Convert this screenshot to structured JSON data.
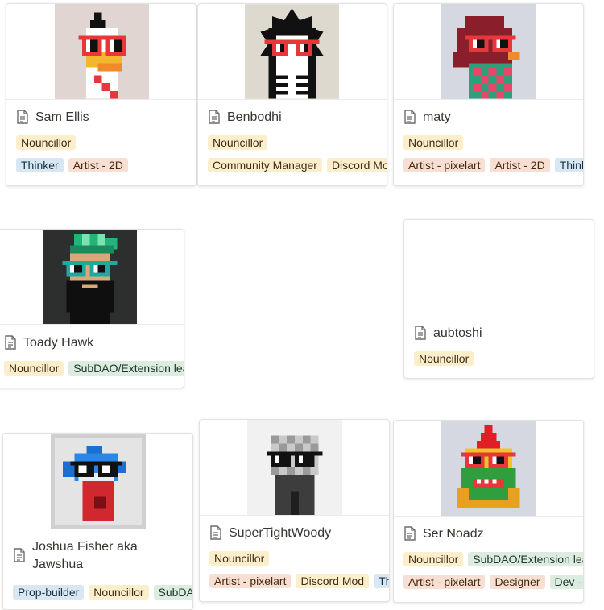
{
  "cards": [
    {
      "name": "Sam Ellis",
      "role": "Nouncillor",
      "tags": [
        {
          "label": "Thinker",
          "color": "blue"
        },
        {
          "label": "Artist - 2D",
          "color": "orange"
        }
      ]
    },
    {
      "name": "Benbodhi",
      "role": "Nouncillor",
      "tags": [
        {
          "label": "Community Manager",
          "color": "yellow"
        },
        {
          "label": "Discord Mod",
          "color": "yellow"
        }
      ]
    },
    {
      "name": "maty",
      "role": "Nouncillor",
      "tags": [
        {
          "label": "Artist - pixelart",
          "color": "orange"
        },
        {
          "label": "Artist - 2D",
          "color": "orange"
        },
        {
          "label": "Thinker",
          "color": "blue"
        }
      ]
    },
    {
      "name": "Toady Hawk",
      "tags": [
        {
          "label": "Nouncillor",
          "color": "yellow"
        },
        {
          "label": "SubDAO/Extension lead",
          "color": "green"
        }
      ]
    },
    {
      "name": "aubtoshi",
      "role": "Nouncillor",
      "tags": []
    },
    {
      "name": "Joshua Fisher aka Jawshua",
      "tags": [
        {
          "label": "Prop-builder",
          "color": "blue"
        },
        {
          "label": "Nouncillor",
          "color": "yellow"
        },
        {
          "label": "SubDAO/Extension lead",
          "color": "green"
        }
      ]
    },
    {
      "name": "SuperTightWoody",
      "role": "Nouncillor",
      "tags": [
        {
          "label": "Artist - pixelart",
          "color": "orange"
        },
        {
          "label": "Discord Mod",
          "color": "yellow"
        },
        {
          "label": "Thinker",
          "color": "blue"
        }
      ]
    },
    {
      "name": "Ser Noadz",
      "tags": [
        {
          "label": "Nouncillor",
          "color": "yellow"
        },
        {
          "label": "SubDAO/Extension lead",
          "color": "green"
        }
      ],
      "tags2": [
        {
          "label": "Artist - pixelart",
          "color": "orange"
        },
        {
          "label": "Designer",
          "color": "orange"
        },
        {
          "label": "Dev - frontend",
          "color": "green"
        }
      ]
    }
  ],
  "colors": {
    "yellow": "#fbeecb",
    "blue": "#d8e7f1",
    "orange": "#f8dfd3",
    "green": "#dcecdf",
    "noggles_red": "#e8373b",
    "noggles_teal": "#1fa8a0"
  },
  "icons": {
    "doc": "page-icon"
  }
}
